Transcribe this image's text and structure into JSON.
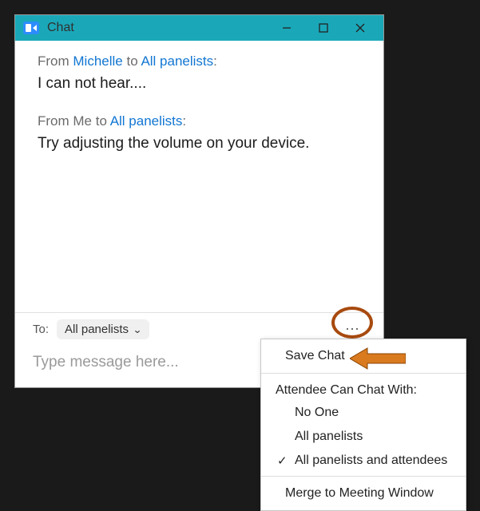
{
  "window": {
    "title": "Chat"
  },
  "messages": [
    {
      "from_label": "From ",
      "from_name": "Michelle",
      "to_label": " to ",
      "to_name": "All panelists",
      "suffix": ":",
      "text": "I can not hear...."
    },
    {
      "from_label": "From Me to ",
      "from_name": "",
      "to_label": "",
      "to_name": "All panelists",
      "suffix": ":",
      "text": "Try adjusting the volume on your device."
    }
  ],
  "to_row": {
    "label": "To:",
    "selected": "All panelists"
  },
  "input": {
    "placeholder": "Type message here..."
  },
  "more_glyph": "⋯",
  "menu": {
    "save": "Save Chat",
    "header": "Attendee Can Chat With:",
    "opt_none": "No One",
    "opt_panelists": "All panelists",
    "opt_all": "All panelists and attendees",
    "merge": "Merge to Meeting Window"
  }
}
